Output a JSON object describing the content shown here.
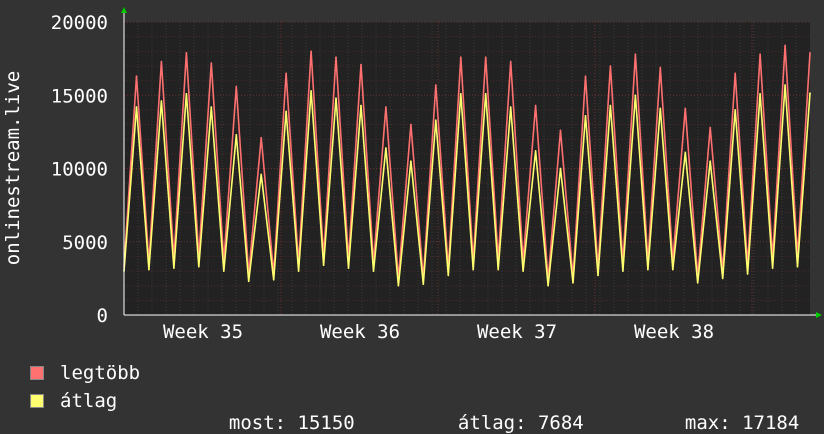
{
  "chart_data": {
    "type": "line",
    "ylabel": "onlinestream.live",
    "y_ticks": [
      0,
      5000,
      10000,
      15000,
      20000
    ],
    "ylim": [
      0,
      20000
    ],
    "x_ticks": [
      "Week 35",
      "Week 36",
      "Week 37",
      "Week 38"
    ],
    "grid": true,
    "background": "#222222",
    "series": [
      {
        "name": "legtöbb",
        "color": "#ff7070",
        "values": [
          3300,
          16300,
          3600,
          17300,
          3900,
          17900,
          4000,
          17200,
          3700,
          15600,
          2800,
          12100,
          2800,
          16500,
          3500,
          18000,
          4000,
          17600,
          3800,
          17100,
          3600,
          14200,
          2500,
          13000,
          2500,
          15700,
          3200,
          17600,
          3700,
          17600,
          3800,
          17300,
          3700,
          14300,
          2400,
          12600,
          2600,
          16300,
          3200,
          17000,
          3600,
          17800,
          3700,
          16900,
          3700,
          14100,
          2600,
          12800,
          3000,
          16500,
          3400,
          17800,
          3900,
          18400,
          4000,
          17900
        ],
        "stat_labels": {
          "name": "legtöbb"
        }
      },
      {
        "name": "átlag",
        "color": "#ffff70",
        "values": [
          3000,
          14200,
          3100,
          14600,
          3200,
          15100,
          3300,
          14200,
          3000,
          12300,
          2300,
          9600,
          2400,
          13900,
          3000,
          15300,
          3400,
          14800,
          3200,
          14300,
          3000,
          11400,
          2000,
          10500,
          2100,
          13300,
          2700,
          15100,
          3100,
          15100,
          3100,
          14200,
          3000,
          11200,
          2000,
          10000,
          2200,
          13600,
          2700,
          14300,
          3000,
          15000,
          3100,
          14100,
          3100,
          11100,
          2200,
          10500,
          2500,
          14000,
          2800,
          15100,
          3200,
          15700,
          3300,
          15150
        ]
      }
    ]
  },
  "stats": {
    "most_label": "most:",
    "most_value": "15150",
    "atlag_label": "átlag:",
    "atlag_value": "7684",
    "max_label": "max:",
    "max_value": "17184"
  }
}
